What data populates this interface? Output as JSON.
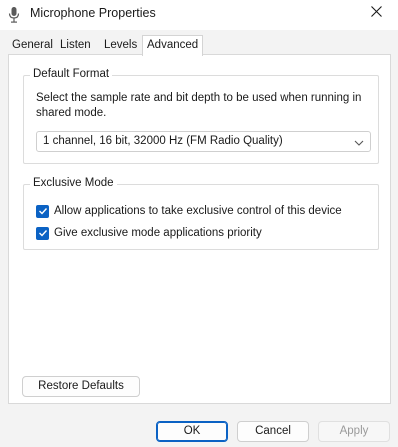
{
  "window": {
    "title": "Microphone Properties",
    "icon": "microphone-icon"
  },
  "tabs": [
    {
      "label": "General"
    },
    {
      "label": "Listen"
    },
    {
      "label": "Levels"
    },
    {
      "label": "Advanced",
      "active": true
    }
  ],
  "default_format": {
    "heading": "Default Format",
    "description": "Select the sample rate and bit depth to be used when running in shared mode.",
    "selected": "1 channel, 16 bit, 32000 Hz (FM Radio Quality)"
  },
  "exclusive_mode": {
    "heading": "Exclusive Mode",
    "options": [
      {
        "label": "Allow applications to take exclusive control of this device",
        "checked": true
      },
      {
        "label": "Give exclusive mode applications priority",
        "checked": true
      }
    ]
  },
  "buttons": {
    "restore_defaults": "Restore Defaults",
    "ok": "OK",
    "cancel": "Cancel",
    "apply": "Apply"
  },
  "colors": {
    "accent": "#0b62c4",
    "background": "#f3f3f3",
    "panel": "#ffffff"
  }
}
